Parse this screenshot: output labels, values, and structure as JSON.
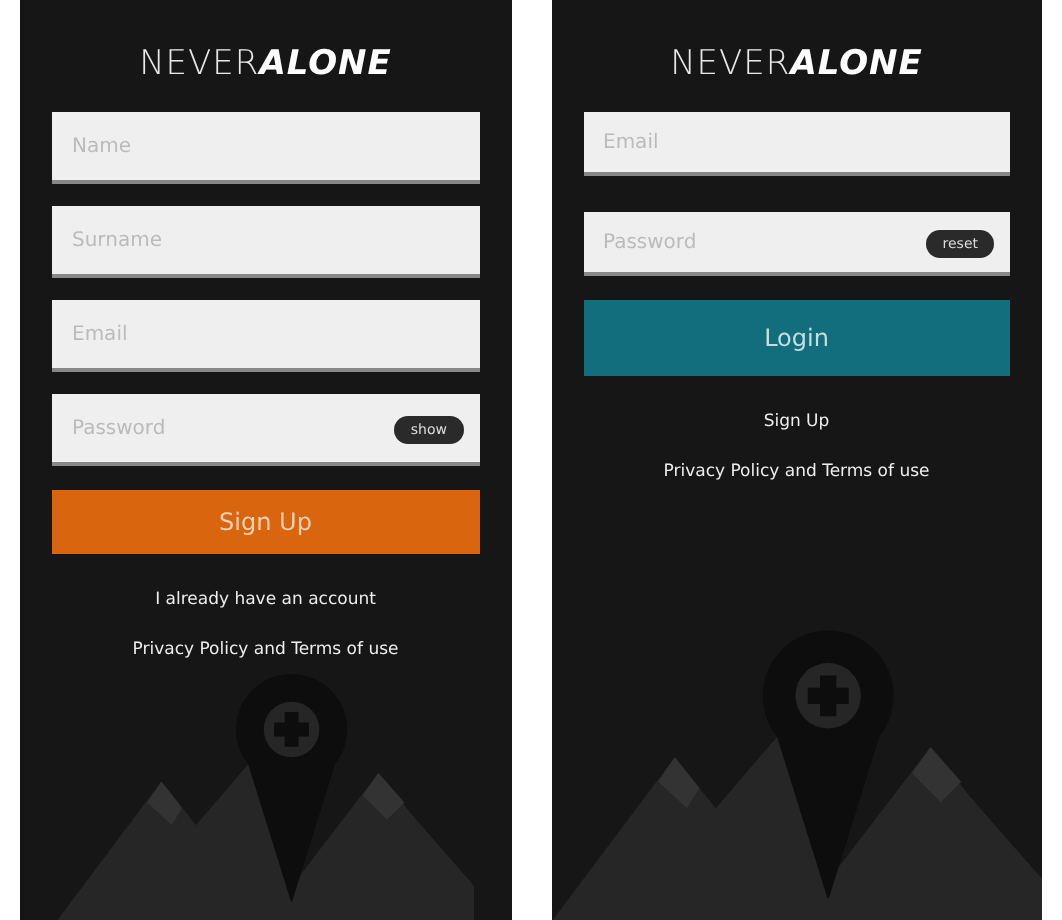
{
  "screens": [
    {
      "kind": "signup",
      "logo": {
        "light": "NEVER",
        "bold": "ALONE"
      },
      "fields": [
        {
          "placeholder": "Name"
        },
        {
          "placeholder": "Surname"
        },
        {
          "placeholder": "Email"
        },
        {
          "placeholder": "Password",
          "toggle": "show"
        }
      ],
      "primary_button": "Sign Up",
      "links": [
        "I already have an account",
        "Privacy Policy and Terms of use"
      ]
    },
    {
      "kind": "login",
      "logo": {
        "light": "NEVER",
        "bold": "ALONE"
      },
      "fields": [
        {
          "placeholder": "Email"
        },
        {
          "placeholder": "Password",
          "toggle": "reset"
        }
      ],
      "primary_button": "Login",
      "links": [
        "Sign Up",
        "Privacy Policy and Terms of use"
      ]
    }
  ]
}
